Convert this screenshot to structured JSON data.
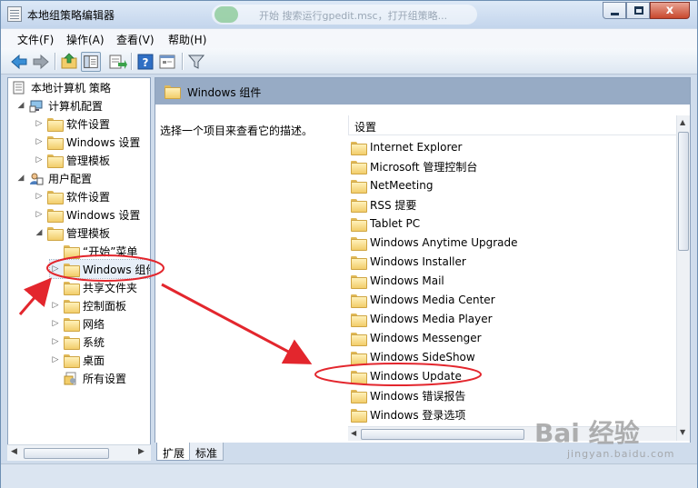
{
  "window": {
    "title": "本地组策略编辑器",
    "watermark_text": "开始  搜索运行gpedit.msc，打开组策略...",
    "close_glyph": "x"
  },
  "menu": [
    "文件(F)",
    "操作(A)",
    "查看(V)",
    "帮助(H)"
  ],
  "toolbar": {
    "icons": [
      "back-icon",
      "forward-icon",
      "up-folder-icon",
      "show-hide-tree-icon",
      "export-list-icon",
      "help-icon",
      "properties-icon",
      "filter-icon"
    ]
  },
  "tree": {
    "root": "本地计算机 策略",
    "computer_config": "计算机配置",
    "cc_software": "软件设置",
    "cc_windows": "Windows 设置",
    "cc_admin": "管理模板",
    "user_config": "用户配置",
    "uc_software": "软件设置",
    "uc_windows": "Windows 设置",
    "uc_admin": "管理模板",
    "start_menu": "“开始”菜单",
    "windows_components": "Windows 组件",
    "shared_folders": "共享文件夹",
    "control_panel": "控制面板",
    "network": "网络",
    "system": "系统",
    "desktop": "桌面",
    "all_settings": "所有设置"
  },
  "right_pane": {
    "header": "Windows 组件",
    "description": "选择一个项目来查看它的描述。",
    "column": "设置",
    "items": [
      "Internet Explorer",
      "Microsoft 管理控制台",
      "NetMeeting",
      "RSS 提要",
      "Tablet PC",
      "Windows Anytime Upgrade",
      "Windows Installer",
      "Windows Mail",
      "Windows Media Center",
      "Windows Media Player",
      "Windows Messenger",
      "Windows SideShow",
      "Windows Update",
      "Windows 错误报告",
      "Windows 登录选项"
    ]
  },
  "tabs": [
    "扩展",
    "标准"
  ],
  "watermark": {
    "brand": "Bai 经验",
    "url": "jingyan.baidu.com"
  },
  "colors": {
    "annotation_red": "#e3262d",
    "header_blue": "#97abc5",
    "folder_yellow": "#f2cd6a"
  }
}
